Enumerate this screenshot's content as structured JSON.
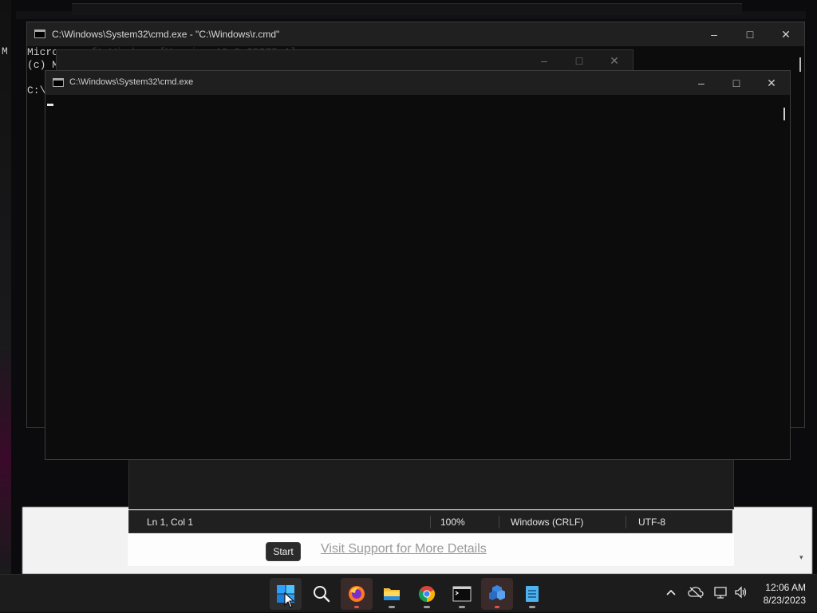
{
  "windows": {
    "back": {
      "title": "C:\\Windows\\System32\\cmd.exe - \"C:\\Windows\\r.cmd\"",
      "console_line1": "Micro",
      "console_line2": "(c) M",
      "console_line4": "C:\\",
      "blurred_version": "ft Windows [Version 10.0.25375.1]"
    },
    "middle": {
      "title": ""
    },
    "front": {
      "title": "C:\\Windows\\System32\\cmd.exe"
    }
  },
  "notepad_status": {
    "position": "Ln 1, Col 1",
    "zoom": "100%",
    "line_ending": "Windows (CRLF)",
    "encoding": "UTF-8"
  },
  "background_page": {
    "link_text": "Visit Support for More Details"
  },
  "tooltip": {
    "text": "Start"
  },
  "taskbar": {
    "items": [
      {
        "name": "start",
        "icon": "windows-logo"
      },
      {
        "name": "search",
        "icon": "search-icon"
      },
      {
        "name": "firefox",
        "icon": "firefox-icon"
      },
      {
        "name": "file-explorer",
        "icon": "folder-icon"
      },
      {
        "name": "chrome",
        "icon": "chrome-icon"
      },
      {
        "name": "terminal",
        "icon": "terminal-icon"
      },
      {
        "name": "app",
        "icon": "puzzle-app-icon"
      },
      {
        "name": "notepad",
        "icon": "notepad-icon"
      }
    ]
  },
  "tray": {
    "time": "12:06 AM",
    "date": "8/23/2023"
  },
  "colors": {
    "taskbar_bg": "#1c1c1c",
    "console_bg": "#0c0c0c",
    "titlebar_bg": "#202020"
  }
}
